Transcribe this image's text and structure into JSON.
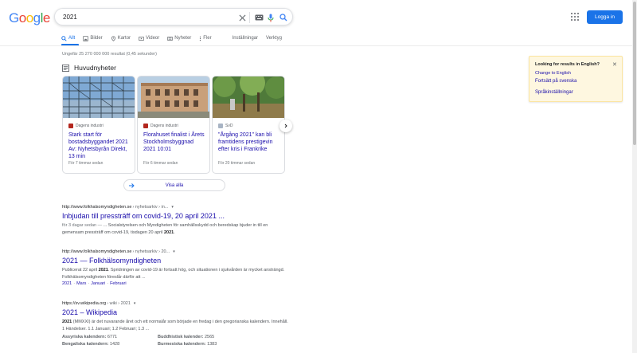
{
  "logo": {
    "letters": [
      "G",
      "o",
      "o",
      "g",
      "l",
      "e"
    ],
    "colors": [
      "#4285f4",
      "#ea4335",
      "#fbbc05",
      "#4285f4",
      "#34a853",
      "#ea4335"
    ]
  },
  "search": {
    "query": "2021",
    "clear_icon": "close-icon",
    "keyboard_icon": "keyboard-icon",
    "mic_icon": "mic-icon",
    "search_icon": "search-icon"
  },
  "header": {
    "apps_icon": "apps-grid-icon",
    "login_label": "Logga in"
  },
  "tabs": [
    {
      "label": "Allt",
      "icon": "search-icon"
    },
    {
      "label": "Bilder",
      "icon": "image-icon"
    },
    {
      "label": "Kartor",
      "icon": "map-pin-icon"
    },
    {
      "label": "Videor",
      "icon": "video-icon"
    },
    {
      "label": "Nyheter",
      "icon": "news-icon"
    },
    {
      "label": "Fler",
      "icon": "more-icon"
    },
    {
      "label": "Inställningar"
    },
    {
      "label": "Verktyg"
    }
  ],
  "stats": "Ungefär 25 270 000 000 resultat (0,45 sekunder)",
  "top_stories": {
    "heading": "Huvudnyheter",
    "cards": [
      {
        "source": "Dagens industri",
        "title": "Stark start för bostadsbyggandet 2021 Av: Nyhetsbyrån Direkt, 13 min",
        "ago": "För 7 timmar sedan"
      },
      {
        "source": "Dagens industri",
        "title": "Florahuset finalist i Årets Stockholmsbyggnad 2021 10:01",
        "ago": "För 6 timmar sedan"
      },
      {
        "source": "SvD",
        "title": "\"Årgång 2021\" kan bli framtidens prestigevin efter kris i Frankrike",
        "ago": "För 20 timmar sedan"
      }
    ],
    "view_all": "Visa alla"
  },
  "results": [
    {
      "url": "http://www.folkhalsomyndigheten.se",
      "path": "› nyhetsarkiv › in...",
      "title": "Inbjudan till pressträff om covid-19, 20 april 2021 ...",
      "date": "för 3 dagar sedan —",
      "snippet_a": " ... Socialstyrelsen och Myndigheten för samhällsskydd och beredskap bjuder in till en gemensam pressträff om covid-19, tisdagen 20 april ",
      "snippet_b": "2021",
      "snippet_c": "."
    },
    {
      "url": "http://www.folkhalsomyndigheten.se",
      "path": "› nyhetsarkiv › 20...",
      "title": "2021 — Folkhälsomyndigheten",
      "snippet_pre": "Publicerat 22 april ",
      "snippet_b": "2021",
      "snippet_c": ". Spridningen av covid-19 är fortsatt hög, och situationen i sjukvården är mycket ansträngd. Folkhälsomyndigheten föreslår därför att ...",
      "sitelinks": [
        "2021",
        "Mars",
        "Januari",
        "Februari"
      ]
    },
    {
      "url": "https://sv.wikipedia.org",
      "path": "› wiki › 2021",
      "title": "2021 – Wikipedia",
      "snippet_b": "2021",
      "snippet_c": " (MMXXI) är det nuvarande året och ett normalår som började en fredag i den gregorianska kalendern. Innehåll. 1 Händelser. 1.1 Januari; 1.2 Februari; 1.3 ...",
      "facts": [
        {
          "label": "Assyriska kalendern:",
          "value": "6771"
        },
        {
          "label": "Buddhistisk kalender:",
          "value": "2565"
        },
        {
          "label": "Bengaliska kalendern:",
          "value": "1428"
        },
        {
          "label": "Burmesiska kalendern:",
          "value": "1383"
        }
      ]
    }
  ],
  "language_box": {
    "heading": "Looking for results in English?",
    "close_icon": "close-icon",
    "change": "Change to English",
    "continue": "Fortsätt på svenska",
    "settings": "Språkinställningar"
  }
}
